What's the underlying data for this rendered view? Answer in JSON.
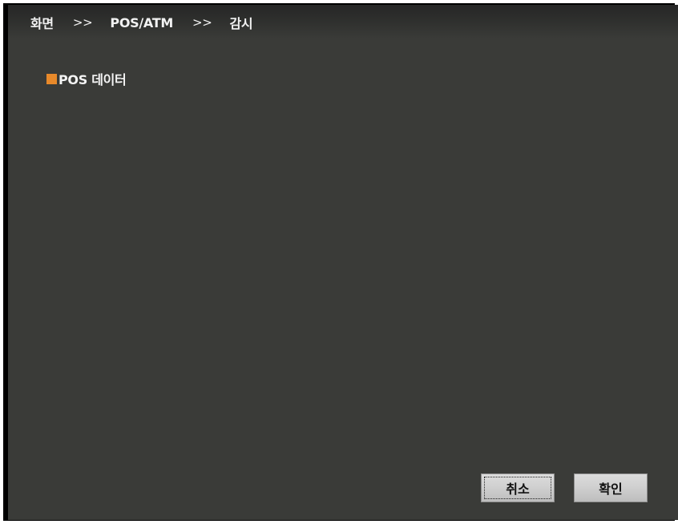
{
  "breadcrumb": {
    "items": [
      "화면",
      "POS/ATM",
      "감시"
    ],
    "separator": ">>"
  },
  "section": {
    "label": "POS 데이터",
    "bullet_color": "#e8892a"
  },
  "buttons": {
    "cancel_label": "취소",
    "ok_label": "확인"
  },
  "colors": {
    "window_background": "#3a3b38",
    "text": "#f2f2f2"
  }
}
